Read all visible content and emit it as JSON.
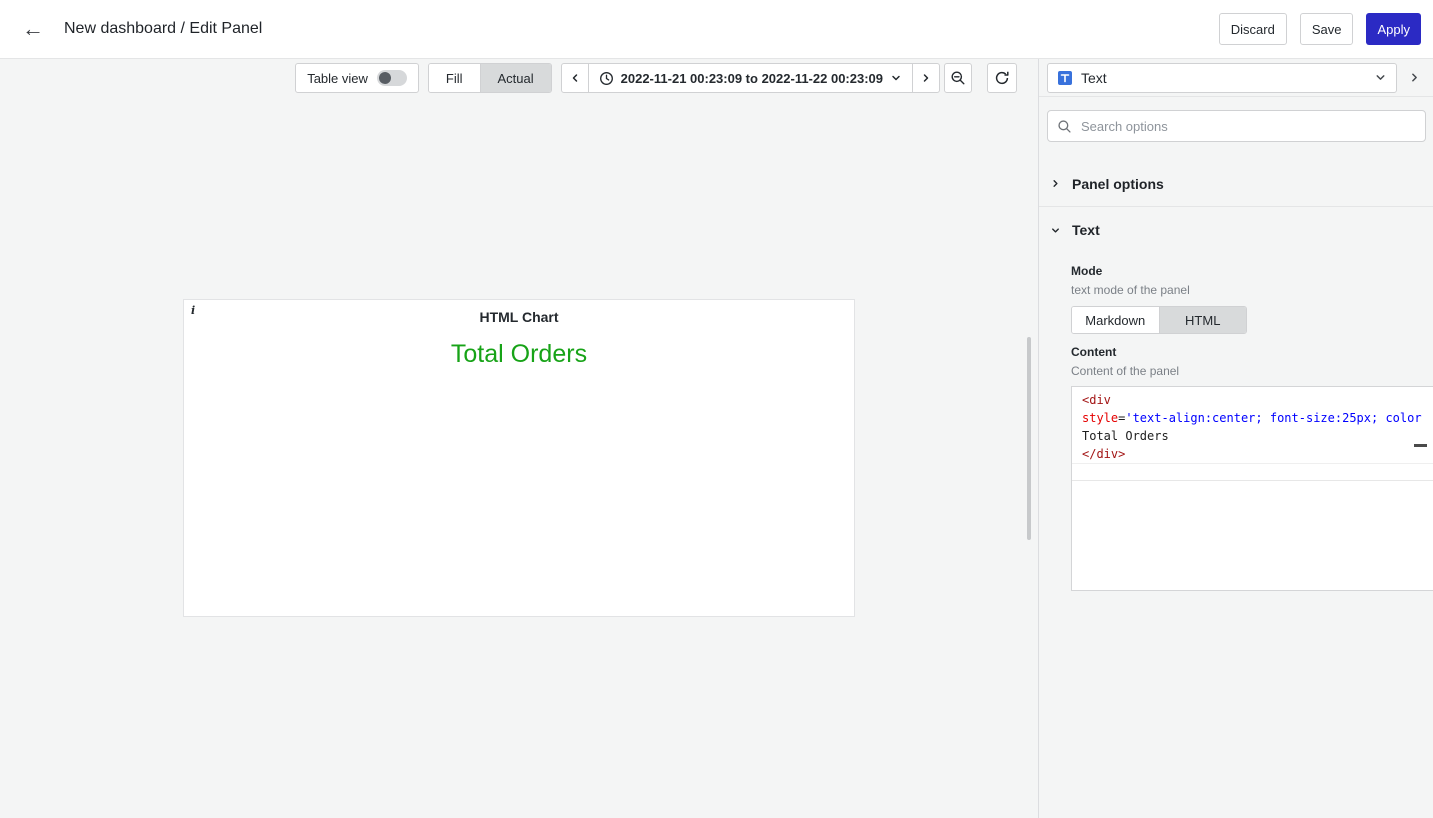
{
  "colors": {
    "primary_button": "#2b2ac4",
    "panel_content_text": "#17a317",
    "code": {
      "tag": "#a31515",
      "attr": "#e50000",
      "string": "#0000ff",
      "plain": "#1e1e1e"
    }
  },
  "icons": {
    "back": "←",
    "info": "i"
  },
  "header": {
    "title": "New dashboard / Edit Panel",
    "buttons": {
      "discard": "Discard",
      "save": "Save",
      "apply": "Apply"
    }
  },
  "toolbar": {
    "table_view_label": "Table view",
    "table_view_enabled": false,
    "display_mode": {
      "options": [
        "Fill",
        "Actual"
      ],
      "selected": "Actual"
    },
    "time_range": "2022-11-21 00:23:09 to 2022-11-22 00:23:09"
  },
  "canvas": {
    "panel": {
      "title": "HTML Chart",
      "content_text": "Total Orders"
    }
  },
  "options_pane": {
    "visualization": "Text",
    "search_placeholder": "Search options",
    "panel_options_section": "Panel options",
    "text_section": "Text",
    "mode": {
      "label": "Mode",
      "description": "text mode of the panel",
      "options": [
        "Markdown",
        "HTML"
      ],
      "selected": "HTML"
    },
    "content": {
      "label": "Content",
      "description": "Content of the panel",
      "code_lines": [
        {
          "tokens": [
            {
              "text": "<div",
              "type": "tag"
            }
          ]
        },
        {
          "tokens": [
            {
              "text": "style",
              "type": "attr"
            },
            {
              "text": "=",
              "type": "plain"
            },
            {
              "text": "'text-align:center; font-size:25px; color",
              "type": "string"
            }
          ]
        },
        {
          "tokens": [
            {
              "text": "Total Orders",
              "type": "plain"
            }
          ]
        },
        {
          "tokens": [
            {
              "text": "</div>",
              "type": "tag"
            }
          ]
        },
        {
          "tokens": [],
          "current": true
        }
      ]
    }
  }
}
